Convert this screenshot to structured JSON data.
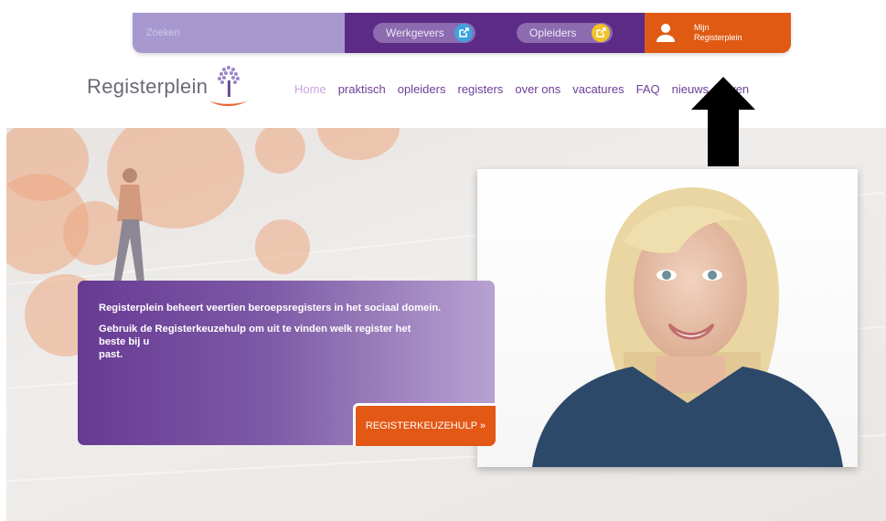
{
  "topbar": {
    "search_placeholder": "Zoeken",
    "werkgevers_label": "Werkgevers",
    "opleiders_label": "Opleiders",
    "account_line1": "Mijn",
    "account_line2": "Registerplein",
    "colors": {
      "search_bg": "#a799cf",
      "portal_bg": "#5b2b86",
      "account_bg": "#e05a14"
    }
  },
  "logo": {
    "text": "Registerplein"
  },
  "nav": {
    "items": [
      "Home",
      "praktisch",
      "opleiders",
      "registers",
      "over ons",
      "vacatures",
      "FAQ",
      "nieuws & even"
    ]
  },
  "hero": {
    "text1": "Registerplein beheert veertien beroepsregisters in het sociaal domein.",
    "text2_line1": "Gebruik de Registerkeuzehulp om uit te vinden welk register het",
    "text2_line2": "beste bij u",
    "text2_line3": "past.",
    "cta_label": "REGISTERKEUZEHULP »"
  },
  "icons": [
    "external-link-icon",
    "user-icon",
    "tree-logo-icon",
    "up-arrow-icon"
  ]
}
